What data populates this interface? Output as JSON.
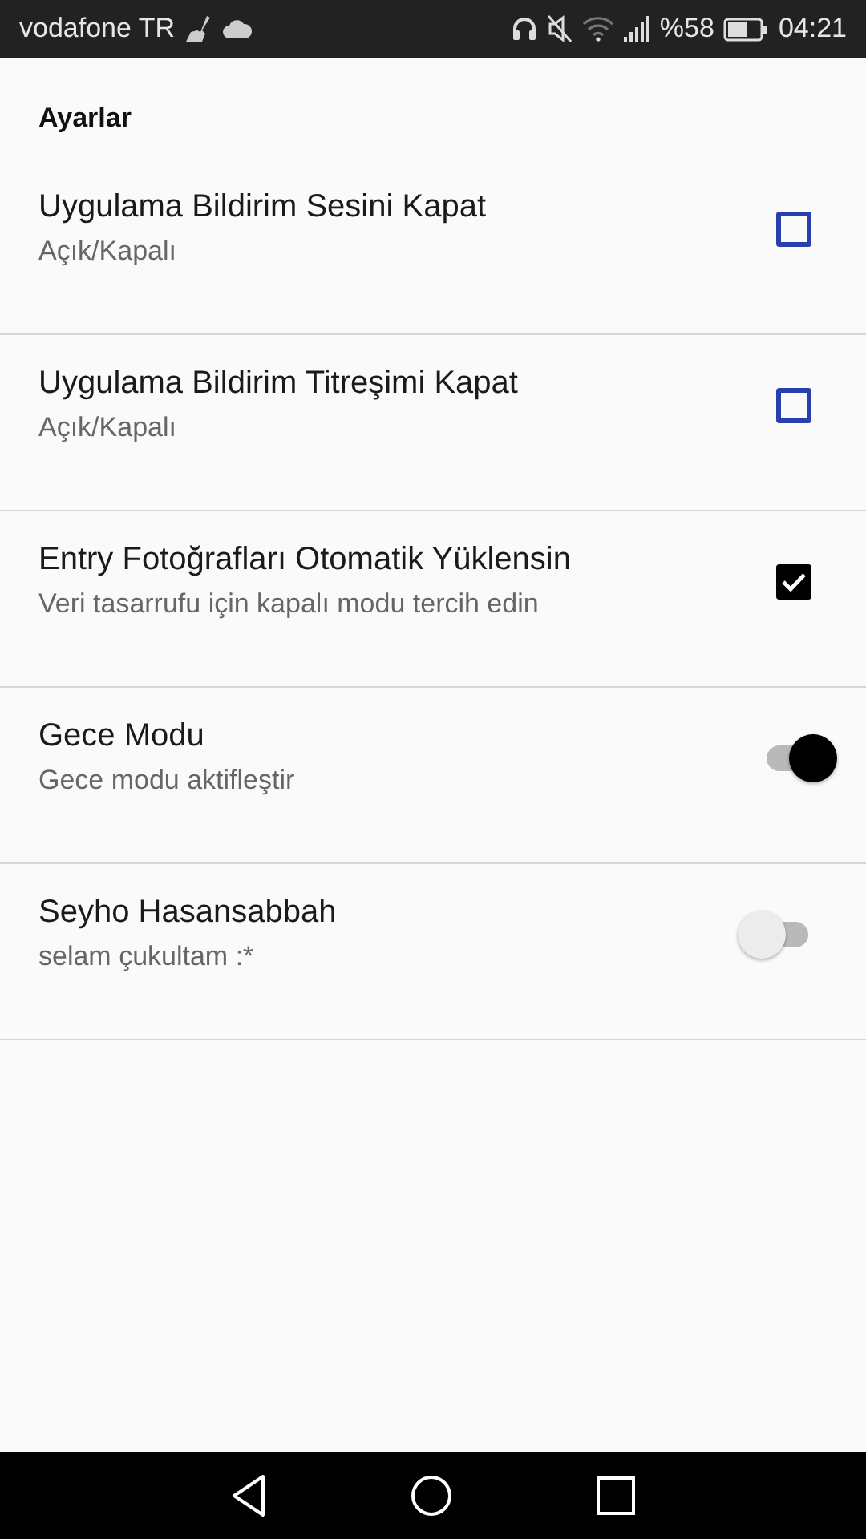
{
  "status_bar": {
    "carrier": "vodafone TR",
    "battery": "%58",
    "time": "04:21"
  },
  "section": {
    "title": "Ayarlar"
  },
  "settings": [
    {
      "kind": "checkbox",
      "title": "Uygulama Bildirim Sesini Kapat",
      "summary": "Açık/Kapalı",
      "on": false
    },
    {
      "kind": "checkbox",
      "title": "Uygulama Bildirim Titreşimi Kapat",
      "summary": "Açık/Kapalı",
      "on": false
    },
    {
      "kind": "checkbox",
      "title": "Entry Fotoğrafları Otomatik Yüklensin",
      "summary": "Veri tasarrufu için kapalı modu tercih edin",
      "on": true
    },
    {
      "kind": "switch",
      "title": "Gece Modu",
      "summary": "Gece modu aktifleştir",
      "on": true
    },
    {
      "kind": "switch",
      "title": "Seyho Hasansabbah",
      "summary": "selam çukultam :*",
      "on": false
    }
  ]
}
